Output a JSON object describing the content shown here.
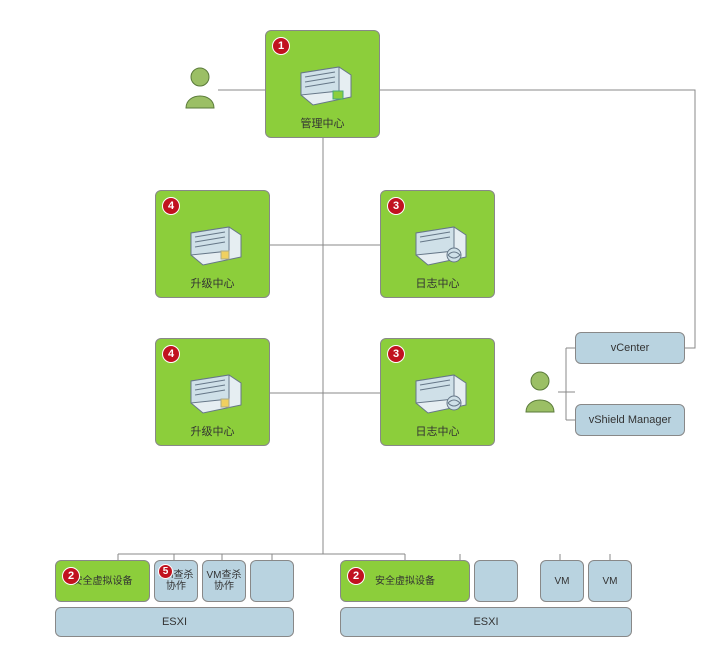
{
  "chart_data": {
    "type": "diagram",
    "title": "",
    "nodes": [
      {
        "id": "mgmt",
        "label": "管理中心",
        "badge": 1,
        "kind": "server-green"
      },
      {
        "id": "upgrade1",
        "label": "升级中心",
        "badge": 4,
        "kind": "server-green"
      },
      {
        "id": "log1",
        "label": "日志中心",
        "badge": 3,
        "kind": "server-green"
      },
      {
        "id": "upgrade2",
        "label": "升级中心",
        "badge": 4,
        "kind": "server-green"
      },
      {
        "id": "log2",
        "label": "日志中心",
        "badge": 3,
        "kind": "server-green"
      },
      {
        "id": "vcenter",
        "label": "vCenter",
        "badge": null,
        "kind": "blue"
      },
      {
        "id": "vshield",
        "label": "vShield Manager",
        "badge": null,
        "kind": "blue"
      },
      {
        "id": "secdev1",
        "label": "安全虚拟设备",
        "badge": 2,
        "kind": "green"
      },
      {
        "id": "vmkill1",
        "label": "VM查杀协作",
        "badge": 5,
        "kind": "blue"
      },
      {
        "id": "vmkill2",
        "label": "VM查杀协作",
        "badge": null,
        "kind": "blue"
      },
      {
        "id": "esxi1",
        "label": "ESXI",
        "badge": null,
        "kind": "blue"
      },
      {
        "id": "secdev2",
        "label": "安全虚拟设备",
        "badge": 2,
        "kind": "green"
      },
      {
        "id": "vm1",
        "label": "VM",
        "badge": null,
        "kind": "blue"
      },
      {
        "id": "vm2",
        "label": "VM",
        "badge": null,
        "kind": "blue"
      },
      {
        "id": "esxi2",
        "label": "ESXI",
        "badge": null,
        "kind": "blue"
      }
    ],
    "edges": [
      [
        "user1",
        "mgmt"
      ],
      [
        "mgmt",
        "vcenter"
      ],
      [
        "mgmt",
        "upgrade1"
      ],
      [
        "mgmt",
        "log1"
      ],
      [
        "mgmt",
        "upgrade2"
      ],
      [
        "mgmt",
        "log2"
      ],
      [
        "upgrade1",
        "log1"
      ],
      [
        "upgrade2",
        "log2"
      ],
      [
        "mgmt",
        "esxi1"
      ],
      [
        "mgmt",
        "esxi2"
      ],
      [
        "user2",
        "vcenter"
      ],
      [
        "user2",
        "vshield"
      ],
      [
        "secdev1",
        "esxi1"
      ],
      [
        "vmkill1",
        "esxi1"
      ],
      [
        "vmkill2",
        "esxi1"
      ],
      [
        "secdev2",
        "esxi2"
      ],
      [
        "vm1",
        "esxi2"
      ],
      [
        "vm2",
        "esxi2"
      ]
    ],
    "annotations": []
  }
}
